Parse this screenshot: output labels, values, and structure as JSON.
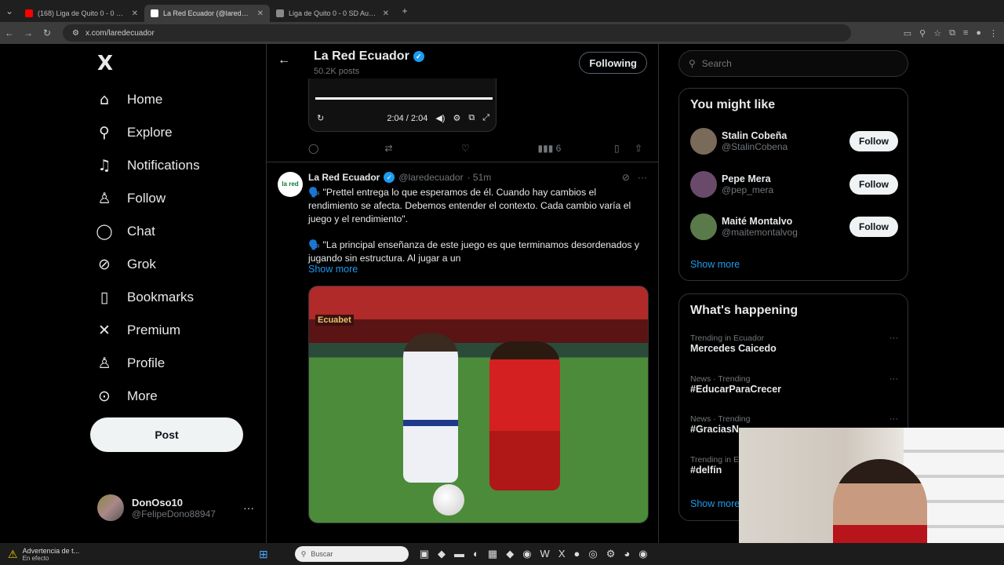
{
  "browser": {
    "tabs": [
      {
        "title": "(168) Liga de Quito 0 - 0 SD Auc",
        "fav": "#ff0000",
        "active": false
      },
      {
        "title": "La Red Ecuador (@laredecuad",
        "fav": "#ffffff",
        "active": true
      },
      {
        "title": "Liga de Quito 0 - 0 SD Aucas (2",
        "fav": "#888888",
        "active": false
      }
    ],
    "url": "x.com/laredecuador"
  },
  "sidebar": {
    "logo": "X",
    "items": [
      {
        "label": "Home",
        "icon": "home-icon",
        "glyph": "⌂"
      },
      {
        "label": "Explore",
        "icon": "search-icon",
        "glyph": "⚲"
      },
      {
        "label": "Notifications",
        "icon": "bell-icon",
        "glyph": "♫"
      },
      {
        "label": "Follow",
        "icon": "person-add-icon",
        "glyph": "♙"
      },
      {
        "label": "Chat",
        "icon": "chat-icon",
        "glyph": "◯"
      },
      {
        "label": "Grok",
        "icon": "grok-icon",
        "glyph": "⊘"
      },
      {
        "label": "Bookmarks",
        "icon": "bookmark-icon",
        "glyph": "▯"
      },
      {
        "label": "Premium",
        "icon": "x-premium-icon",
        "glyph": "✕"
      },
      {
        "label": "Profile",
        "icon": "profile-icon",
        "glyph": "♙"
      },
      {
        "label": "More",
        "icon": "more-circle-icon",
        "glyph": "⊙"
      }
    ],
    "post_label": "Post",
    "account": {
      "name": "DonOso10",
      "handle": "@FelipeDono88947"
    }
  },
  "profile_header": {
    "name": "La Red Ecuador",
    "posts": "50.2K posts",
    "follow_label": "Following"
  },
  "video": {
    "time": "2:04 / 2:04"
  },
  "prev_actions": {
    "views": "6"
  },
  "tweet": {
    "name": "La Red Ecuador",
    "handle": "@laredecuador",
    "time": "· 51m",
    "avatar_text": "la red",
    "para1": "🗣️ \"Prettel entrega lo que esperamos de él. Cuando hay cambios el rendimiento se afecta. Debemos entender el contexto. Cada cambio varía el juego y el rendimiento\".",
    "para2": "🗣️ \"La principal enseñanza de este juego es que terminamos desordenados y jugando sin estructura. Al jugar a un",
    "show_more": "Show more",
    "photo_brand": "Ecuabet"
  },
  "right": {
    "search_placeholder": "Search",
    "might_like_title": "You might like",
    "suggestions": [
      {
        "name": "Stalin Cobeña",
        "handle": "@StalinCobena",
        "button": "Follow",
        "color": "#7a6a5a"
      },
      {
        "name": "Pepe Mera",
        "handle": "@pep_mera",
        "button": "Follow",
        "color": "#6a4a6a"
      },
      {
        "name": "Maité Montalvo",
        "handle": "@maitemontalvog",
        "button": "Follow",
        "color": "#5a7a4a"
      }
    ],
    "show_more": "Show more",
    "happening_title": "What's happening",
    "trends": [
      {
        "context": "Trending in Ecuador",
        "topic": "Mercedes Caicedo"
      },
      {
        "context": "News · Trending",
        "topic": "#EducarParaCrecer"
      },
      {
        "context": "News · Trending",
        "topic": "#GraciasN"
      },
      {
        "context": "Trending in E",
        "topic": "#delfín"
      }
    ],
    "show_more2": "Show more"
  },
  "taskbar": {
    "warning_title": "Advertencia de t...",
    "warning_sub": "En efecto",
    "search_placeholder": "Buscar"
  },
  "colors": {
    "accent": "#1d9bf0",
    "background": "#000000",
    "border": "#2f3336"
  }
}
